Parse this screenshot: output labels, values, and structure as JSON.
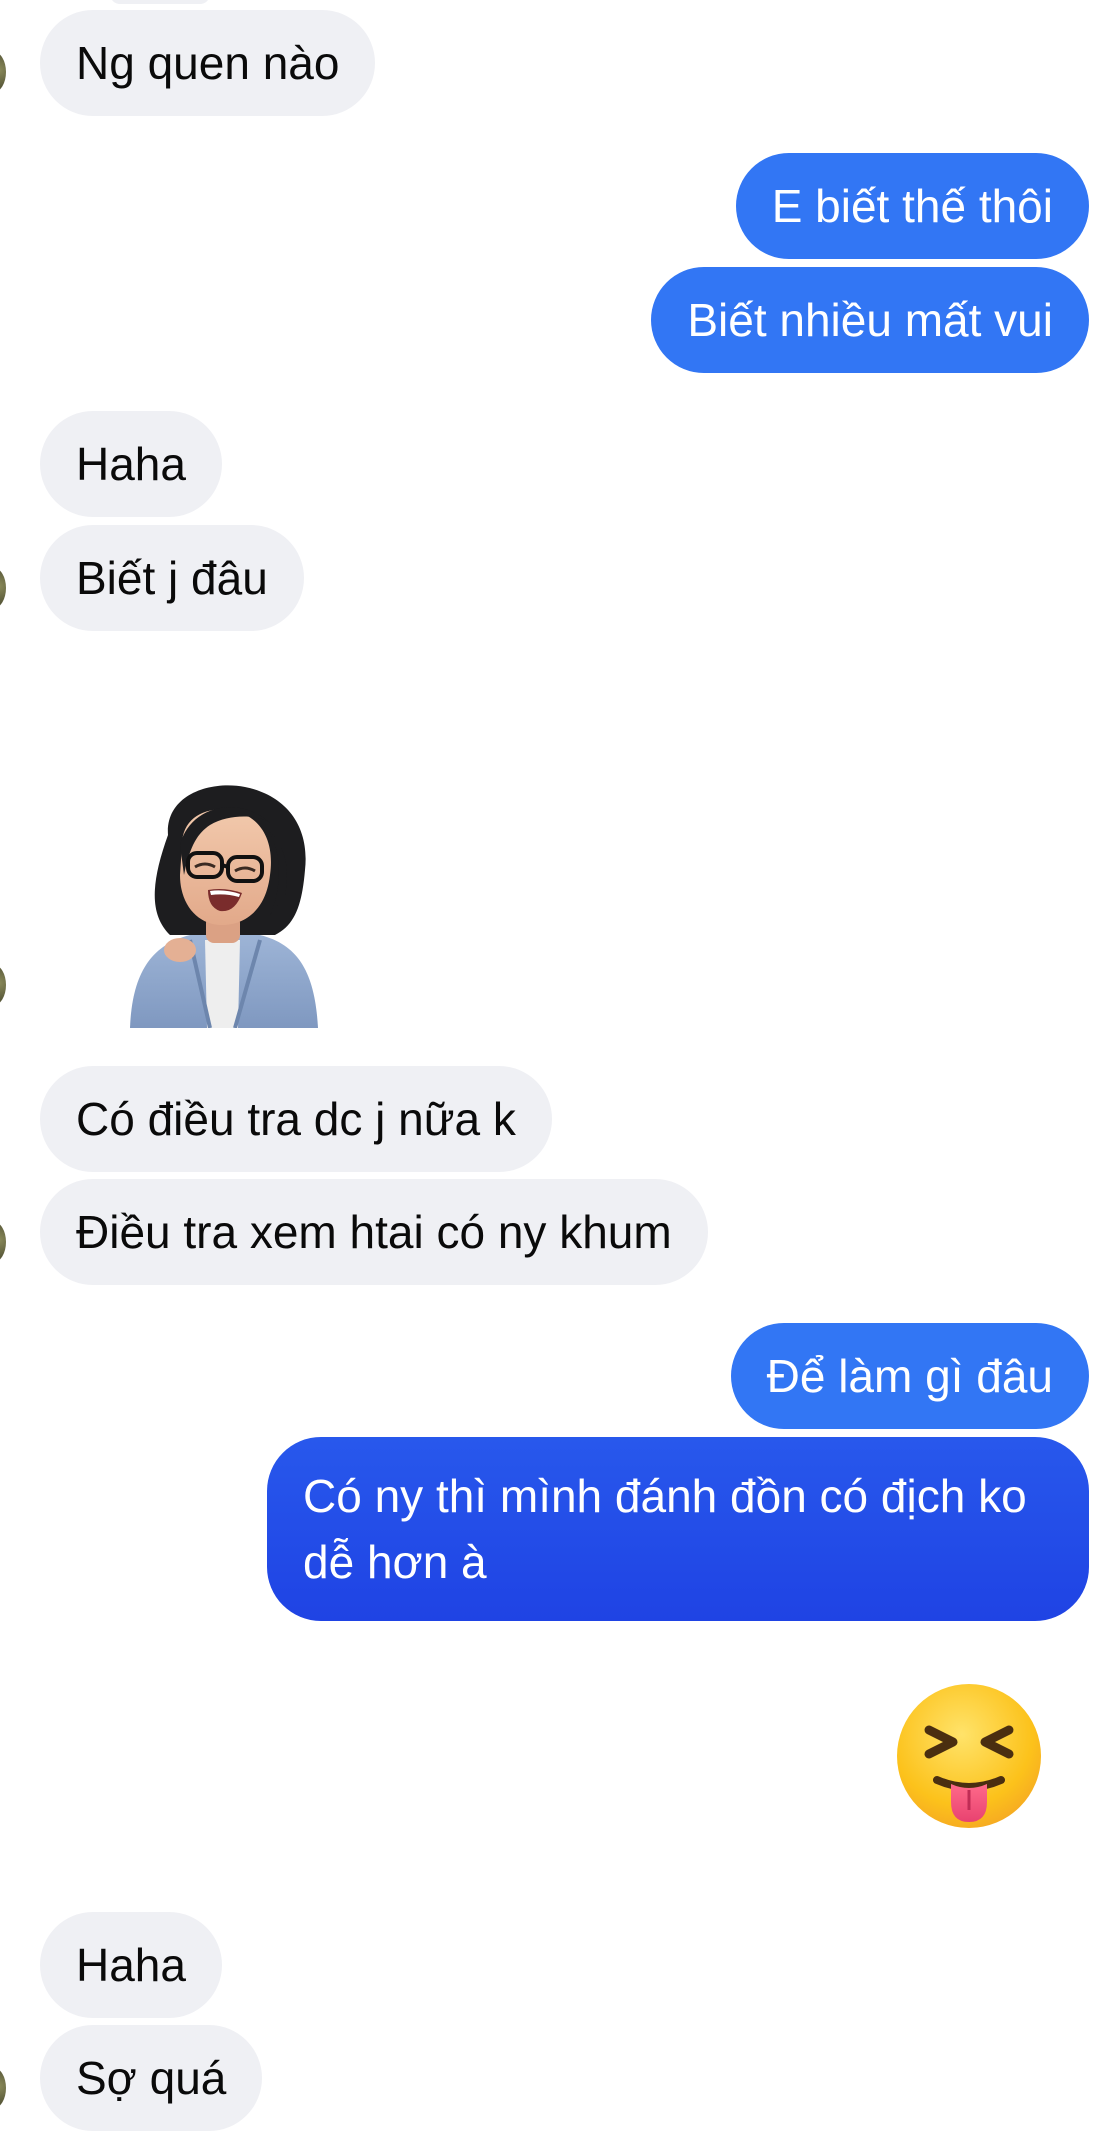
{
  "conversation": {
    "messages": [
      {
        "sender": "them",
        "text": "Ng quen nào"
      },
      {
        "sender": "me",
        "text": "E biết thế thôi"
      },
      {
        "sender": "me",
        "text": "Biết nhiều mất vui"
      },
      {
        "sender": "them",
        "text": "Haha"
      },
      {
        "sender": "them",
        "text": "Biết j đâu"
      },
      {
        "sender": "them",
        "type": "sticker",
        "icon": "laughing-avatar-sticker"
      },
      {
        "sender": "them",
        "text": "Có điều tra dc j nữa k"
      },
      {
        "sender": "them",
        "text": "Điều tra xem htai có ny khum"
      },
      {
        "sender": "me",
        "text": "Để làm gì đâu"
      },
      {
        "sender": "me",
        "text": "Có ny thì mình đánh đồn có địch ko dễ hơn à"
      },
      {
        "sender": "me",
        "type": "emoji",
        "icon": "squinting-face-with-tongue-emoji"
      },
      {
        "sender": "them",
        "text": "Haha"
      },
      {
        "sender": "them",
        "text": "Sợ quá"
      }
    ]
  },
  "colors": {
    "received_bubble": "#eff0f4",
    "sent_bubble": "#3276f4",
    "sent_bubble_dark": "#1f43e4",
    "received_text": "#0a0a0a",
    "sent_text": "#ffffff"
  }
}
